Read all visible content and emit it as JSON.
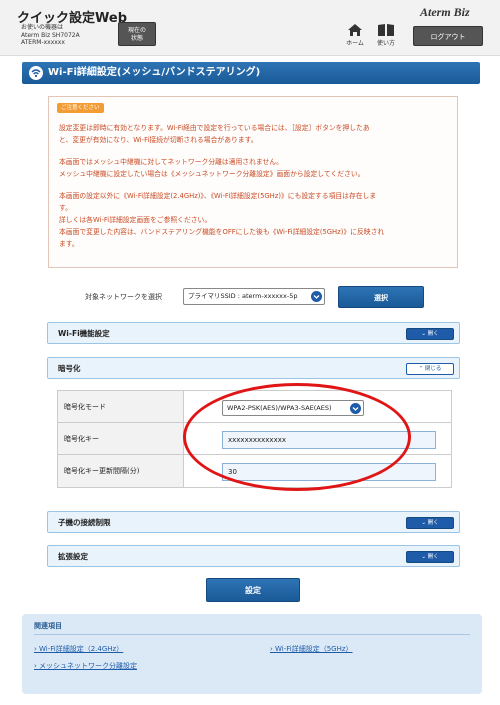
{
  "header": {
    "app_title": "クイック設定Web",
    "device_label": "お使いの機器は",
    "device_model": "Aterm Biz SH7072A",
    "device_name": "ATERM-xxxxxx",
    "status_button": "現在の\n状態",
    "home_label": "ホーム",
    "guide_label": "使い方",
    "brand": "Aterm Biz",
    "logout_button": "ログアウト"
  },
  "page": {
    "title": "Wi-Fi詳細設定(メッシュ/バンドステアリング)"
  },
  "notice": {
    "badge": "ご注意ください",
    "lines": [
      "設定変更は即時に有効となります。Wi-Fi経由で設定を行っている場合には、［設定］ボタンを押したあ",
      "と、変更が有効になり、Wi-Fi接続が切断される場合があります。",
      "本画面ではメッシュ中継機に対してネットワーク分離は適用されません。",
      "メッシュ中継機に設定したい場合は《メッシュネットワーク分離設定》画面から設定してください。",
      "本画面の設定以外に《Wi-Fi詳細設定(2.4GHz)》、《Wi-Fi詳細設定(5GHz)》にも設定する項目は存在しま",
      "す。",
      "詳しくは各Wi-Fi詳細設定画面をご参照ください。",
      "本画面で変更した内容は、バンドステアリング機能をOFFにした後も《Wi-Fi詳細設定(5GHz)》に反映され",
      "ます。"
    ]
  },
  "network_select": {
    "label": "対象ネットワークを選択",
    "value": "プライマリSSID : aterm-xxxxxx-5p",
    "button": "選択"
  },
  "sections": {
    "wifi_function": {
      "label": "Wi-Fi機能設定",
      "button": "開く"
    },
    "encryption": {
      "label": "暗号化",
      "button": "閉じる"
    },
    "child_connection": {
      "label": "子機の接続制限",
      "button": "開く"
    },
    "extended": {
      "label": "拡張設定",
      "button": "開く"
    }
  },
  "encryption_fields": {
    "mode_label": "暗号化モード",
    "mode_value": "WPA2-PSK(AES)/WPA3-SAE(AES)",
    "key_label": "暗号化キー",
    "key_value": "xxxxxxxxxxxxxx",
    "interval_label": "暗号化キー更新間隔(分)",
    "interval_value": "30"
  },
  "settings_button": "設定",
  "related": {
    "title": "関連項目",
    "links": [
      "Wi-Fi詳細設定（2.4GHz）",
      "Wi-Fi詳細設定（5GHz）",
      "メッシュネットワーク分離設定"
    ]
  },
  "colors": {
    "primary_blue": "#1e5ba8",
    "notice_text": "#c84a24",
    "highlight_red": "#e01616",
    "badge_orange": "#f29c33"
  }
}
